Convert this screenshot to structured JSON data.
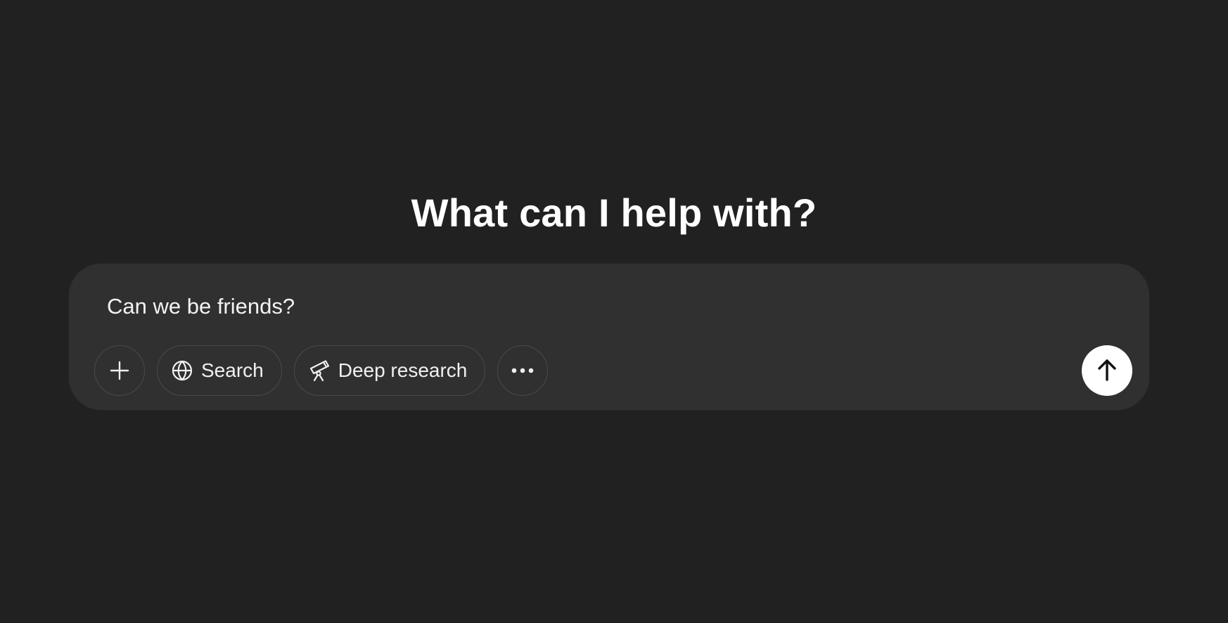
{
  "main": {
    "heading": "What can I help with?"
  },
  "composer": {
    "input_value": "Can we be friends?",
    "toolbar": {
      "add_icon": "plus-icon",
      "search_label": "Search",
      "search_icon": "globe-icon",
      "deep_research_label": "Deep research",
      "deep_research_icon": "telescope-icon",
      "more_icon": "ellipsis-icon"
    },
    "send_icon": "arrow-up-icon"
  },
  "colors": {
    "background": "#212121",
    "composer_background": "#303030",
    "pill_border": "#4a4a4a",
    "send_button": "#ffffff"
  }
}
